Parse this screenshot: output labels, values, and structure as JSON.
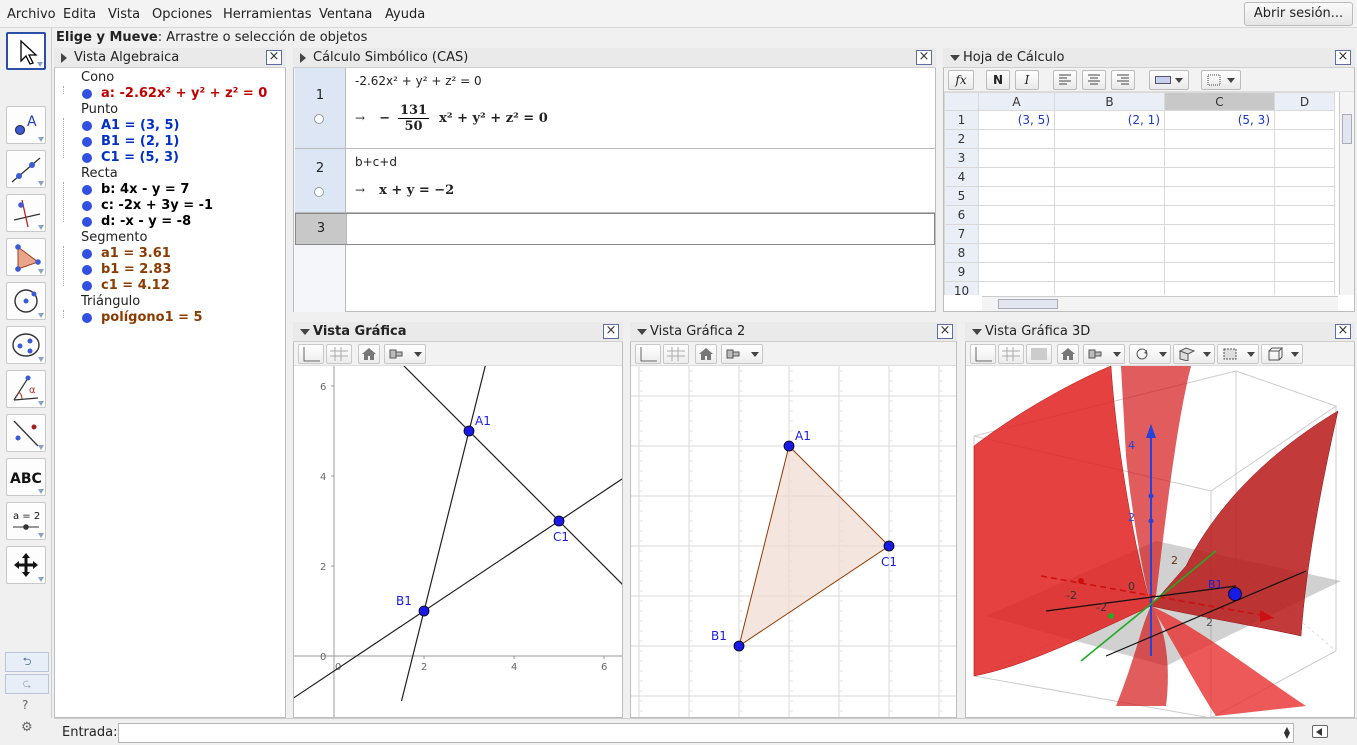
{
  "menu": [
    "Archivo",
    "Edita",
    "Vista",
    "Opciones",
    "Herramientas",
    "Ventana",
    "Ayuda"
  ],
  "login_label": "Abrir sesión...",
  "mode": {
    "name": "Elige y Mueve",
    "desc": ": Arrastre o selección de objetos"
  },
  "tools": [
    "move",
    "point",
    "line",
    "perpendicular",
    "polygon",
    "circle",
    "conic",
    "angle",
    "reflect",
    "text",
    "slider",
    "move-view"
  ],
  "tool_text": {
    "abc": "ABC",
    "slider": "a = 2"
  },
  "algebra": {
    "title": "Vista Algebraica",
    "groups": [
      {
        "name": "Cono",
        "color": "#c00000",
        "items": [
          {
            "text": "a: -2.62x² + y² + z² = 0",
            "dot": "#3050e0"
          }
        ]
      },
      {
        "name": "Punto",
        "color": "#0030c8",
        "items": [
          {
            "text": "A1 = (3, 5)",
            "dot": "#3050e0"
          },
          {
            "text": "B1 = (2, 1)",
            "dot": "#3050e0"
          },
          {
            "text": "C1 = (5, 3)",
            "dot": "#3050e0"
          }
        ]
      },
      {
        "name": "Recta",
        "color": "#000000",
        "items": [
          {
            "text": "b: 4x - y = 7",
            "dot": "#3050e0"
          },
          {
            "text": "c: -2x + 3y = -1",
            "dot": "#3050e0"
          },
          {
            "text": "d: -x - y = -8",
            "dot": "#3050e0"
          }
        ]
      },
      {
        "name": "Segmento",
        "color": "#8b3a00",
        "items": [
          {
            "text": "a1 = 3.61",
            "dot": "#3050e0"
          },
          {
            "text": "b1 = 2.83",
            "dot": "#3050e0"
          },
          {
            "text": "c1 = 4.12",
            "dot": "#3050e0"
          }
        ]
      },
      {
        "name": "Triángulo",
        "color": "#8b3a00",
        "items": [
          {
            "text": "polígono1 = 5",
            "dot": "#3050e0"
          }
        ]
      }
    ]
  },
  "cas": {
    "title": "Cálculo Simbólico (CAS)",
    "rows": [
      {
        "num": "1",
        "input": "-2.62x² + y² + z² = 0",
        "out_prefix": "−",
        "frac_num": "131",
        "frac_den": "50",
        "out_rest": "x² + y² + z² = 0"
      },
      {
        "num": "2",
        "input": "b+c+d",
        "out_rest": "x + y = −2"
      },
      {
        "num": "3"
      }
    ],
    "arrow": "→"
  },
  "sheet": {
    "title": "Hoja de Cálculo",
    "fx": "fx",
    "bold": "N",
    "italic": "I",
    "columns": [
      "A",
      "B",
      "C",
      "D"
    ],
    "rows": [
      "1",
      "2",
      "3",
      "4",
      "5",
      "6",
      "7",
      "8",
      "9",
      "10"
    ],
    "row1": [
      "(3, 5)",
      "(2, 1)",
      "(5, 3)",
      ""
    ]
  },
  "graphics1": {
    "title": "Vista Gráfica",
    "yticks": [
      "6",
      "4",
      "2",
      "0"
    ],
    "xticks": [
      "0",
      "2",
      "4",
      "6"
    ],
    "points": [
      "A1",
      "B1",
      "C1"
    ]
  },
  "graphics2": {
    "title": "Vista Gráfica 2",
    "points": [
      "A1",
      "B1",
      "C1"
    ]
  },
  "graphics3d": {
    "title": "Vista Gráfica 3D",
    "labels": [
      "4",
      "2",
      "2",
      "-2",
      "0",
      "-2",
      "2",
      "B1"
    ]
  },
  "input": {
    "label": "Entrada:"
  },
  "side_buttons": {
    "undo": "⮌",
    "redo": "⮎",
    "help": "?",
    "settings": "⚙"
  }
}
